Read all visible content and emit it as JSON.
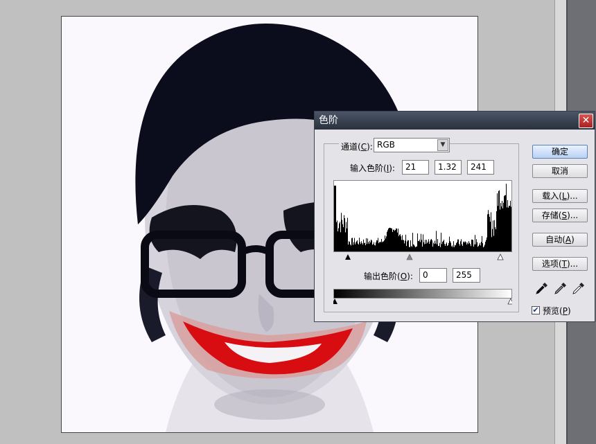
{
  "dialog": {
    "title": "色阶",
    "close_glyph": "✕",
    "channel": {
      "label_pre": "通道(",
      "key": "C",
      "label_post": "):",
      "value": "RGB"
    },
    "input_levels": {
      "label_pre": "输入色阶(",
      "key": "I",
      "label_post": "):",
      "black": "21",
      "gamma": "1.32",
      "white": "241"
    },
    "output_levels": {
      "label_pre": "输出色阶(",
      "key": "O",
      "label_post": "):",
      "black": "0",
      "white": "255"
    },
    "buttons": {
      "ok": "确定",
      "cancel": "取消",
      "load": {
        "pre": "载入(",
        "key": "L",
        "post": ")..."
      },
      "save": {
        "pre": "存储(",
        "key": "S",
        "post": ")..."
      },
      "auto": {
        "pre": "自动(",
        "key": "A",
        "post": ")"
      },
      "options": {
        "pre": "选项(",
        "key": "T",
        "post": ")..."
      }
    },
    "eyedroppers": [
      "black-eyedropper-icon",
      "gray-eyedropper-icon",
      "white-eyedropper-icon"
    ],
    "preview": {
      "pre": "预览(",
      "key": "P",
      "post": ")",
      "checked": true,
      "check_glyph": "✔"
    }
  },
  "colors": {
    "title_bar": "#2f3745",
    "dialog_bg": "#e4e4e8",
    "workspace": "#c0c0c0",
    "lipstick": "#d80d12"
  }
}
